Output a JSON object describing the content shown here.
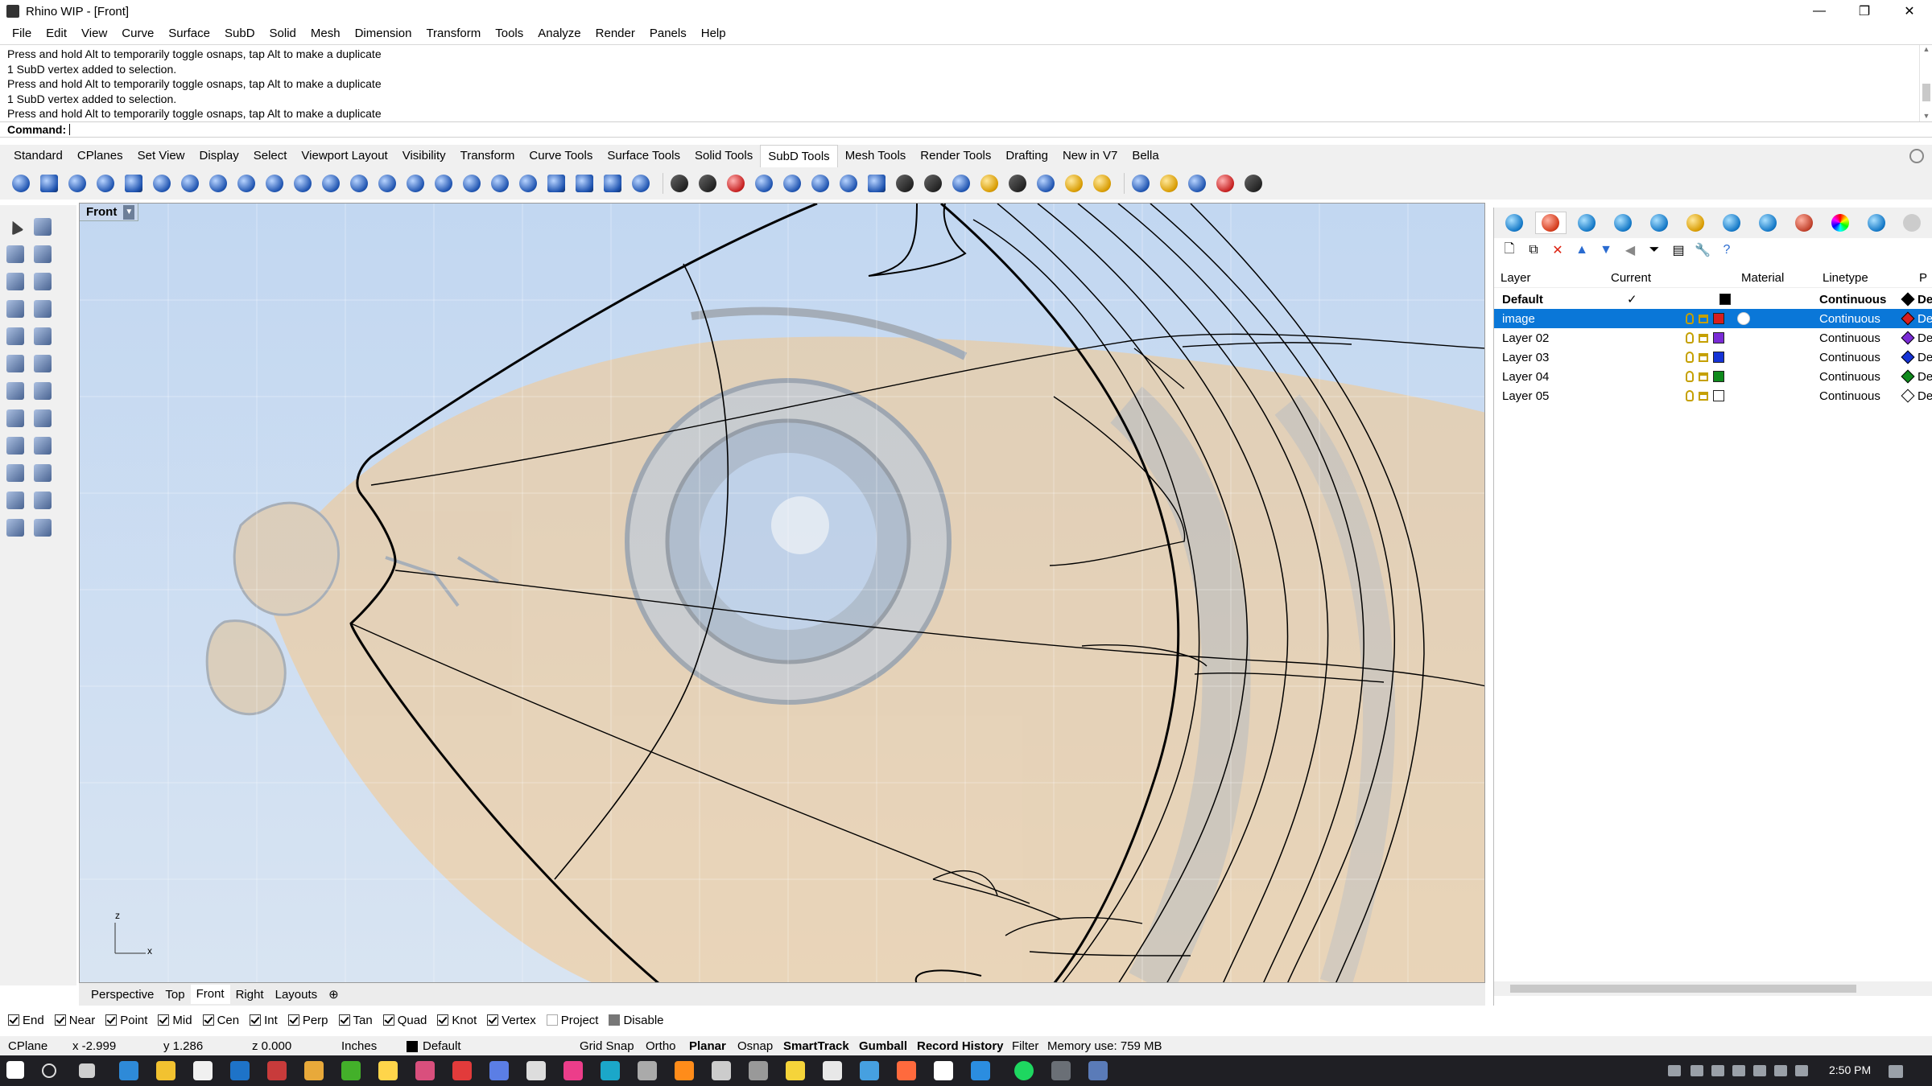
{
  "window": {
    "title": "Rhino WIP - [Front]",
    "controls": [
      "—",
      "❐",
      "✕"
    ]
  },
  "menu": [
    "File",
    "Edit",
    "View",
    "Curve",
    "Surface",
    "SubD",
    "Solid",
    "Mesh",
    "Dimension",
    "Transform",
    "Tools",
    "Analyze",
    "Render",
    "Panels",
    "Help"
  ],
  "command_history": [
    "Press and hold Alt to temporarily toggle osnaps, tap Alt to make a duplicate",
    "1 SubD vertex added to selection.",
    "Press and hold Alt to temporarily toggle osnaps, tap Alt to make a duplicate",
    "1 SubD vertex added to selection.",
    "Press and hold Alt to temporarily toggle osnaps, tap Alt to make a duplicate"
  ],
  "command_prompt": "Command:",
  "toolbar_tabs": [
    "Standard",
    "CPlanes",
    "Set View",
    "Display",
    "Select",
    "Viewport Layout",
    "Visibility",
    "Transform",
    "Curve Tools",
    "Surface Tools",
    "Solid Tools",
    "SubD Tools",
    "Mesh Tools",
    "Render Tools",
    "Drafting",
    "New in V7",
    "Bella"
  ],
  "active_toolbar_tab": "SubD Tools",
  "viewport": {
    "name": "Front",
    "axis_z": "z",
    "axis_x": "x"
  },
  "viewport_tabs": [
    "Perspective",
    "Top",
    "Front",
    "Right",
    "Layouts"
  ],
  "active_viewport_tab": "Front",
  "viewport_tab_add": "⊕",
  "layers_panel": {
    "columns": {
      "layer": "Layer",
      "current": "Current",
      "material": "Material",
      "linetype": "Linetype",
      "print": "P"
    },
    "rows": [
      {
        "name": "Default",
        "current": "✓",
        "color": "#000000",
        "linetype": "Continuous",
        "print_color": "#000000",
        "bold": true,
        "selected": false
      },
      {
        "name": "image",
        "current": "",
        "color": "#d81e1e",
        "linetype": "Continuous",
        "print_color": "#d81e1e",
        "bold": false,
        "selected": true
      },
      {
        "name": "Layer 02",
        "current": "",
        "color": "#7a2bd6",
        "linetype": "Continuous",
        "print_color": "#7a2bd6",
        "bold": false,
        "selected": false
      },
      {
        "name": "Layer 03",
        "current": "",
        "color": "#1533d6",
        "linetype": "Continuous",
        "print_color": "#1533d6",
        "bold": false,
        "selected": false
      },
      {
        "name": "Layer 04",
        "current": "",
        "color": "#0f8a1c",
        "linetype": "Continuous",
        "print_color": "#0f8a1c",
        "bold": false,
        "selected": false
      },
      {
        "name": "Layer 05",
        "current": "",
        "color": "#ffffff",
        "linetype": "Continuous",
        "print_color": "#ffffff",
        "bold": false,
        "selected": false
      }
    ],
    "print_truncated": "De"
  },
  "osnaps": [
    {
      "label": "End",
      "checked": true
    },
    {
      "label": "Near",
      "checked": true
    },
    {
      "label": "Point",
      "checked": true
    },
    {
      "label": "Mid",
      "checked": true
    },
    {
      "label": "Cen",
      "checked": true
    },
    {
      "label": "Int",
      "checked": true
    },
    {
      "label": "Perp",
      "checked": true
    },
    {
      "label": "Tan",
      "checked": true
    },
    {
      "label": "Quad",
      "checked": true
    },
    {
      "label": "Knot",
      "checked": true
    },
    {
      "label": "Vertex",
      "checked": true
    },
    {
      "label": "Project",
      "checked": false
    },
    {
      "label": "Disable",
      "checked": false
    }
  ],
  "status": {
    "cplane": "CPlane",
    "x": "x -2.999",
    "y": "y 1.286",
    "z": "z 0.000",
    "units": "Inches",
    "layer": "Default",
    "grid_snap": "Grid Snap",
    "ortho": "Ortho",
    "planar": "Planar",
    "osnap": "Osnap",
    "smarttrack": "SmartTrack",
    "gumball": "Gumball",
    "record_history": "Record History",
    "filter": "Filter",
    "memory": "Memory use: 759 MB"
  },
  "taskbar": {
    "time": "2:50 PM"
  },
  "colors": {
    "selection": "#0a77d8",
    "viewport_bg": "#c9dcf3",
    "image_tint": "#f2c98a"
  }
}
